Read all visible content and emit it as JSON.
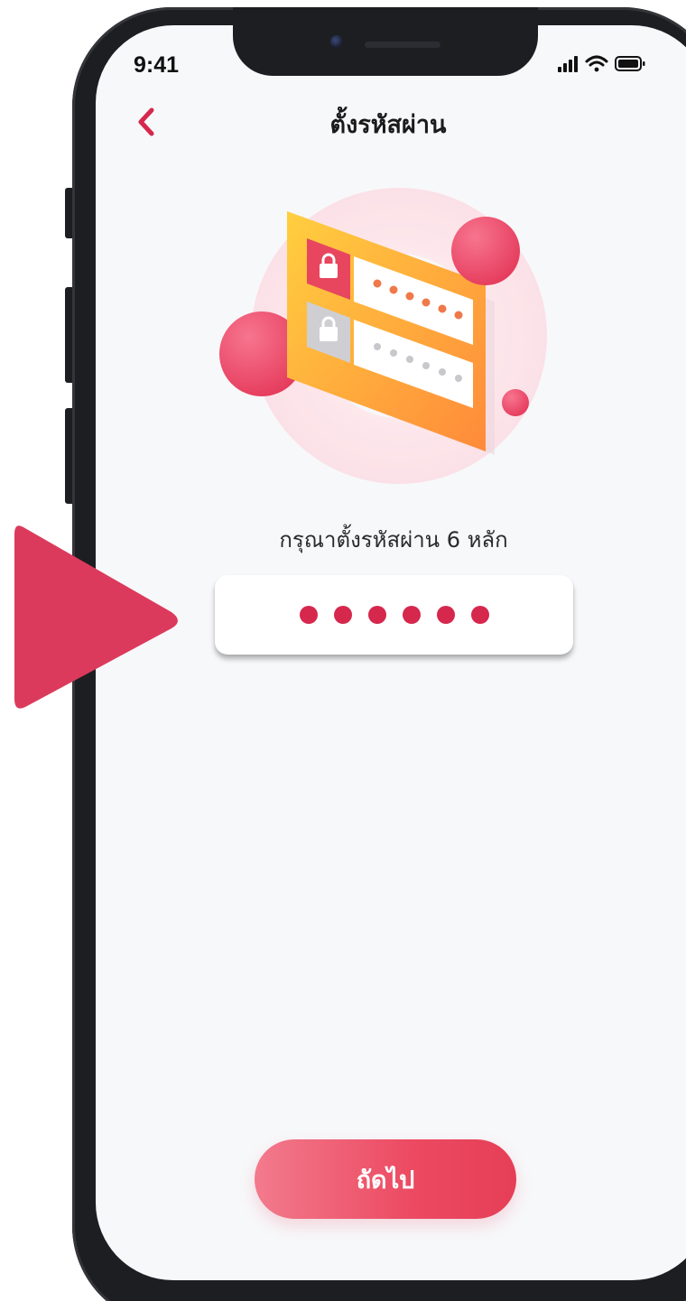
{
  "status_bar": {
    "time": "9:41",
    "signal_icon": "cellular-signal-icon",
    "wifi_icon": "wifi-icon",
    "battery_icon": "battery-icon"
  },
  "header": {
    "back_icon": "chevron-left-icon",
    "title": "ตั้งรหัสผ่าน"
  },
  "illustration": {
    "icon": "password-lock-illustration"
  },
  "pin_setup": {
    "prompt": "กรุณาตั้งรหัสผ่าน 6 หลัก",
    "entered_digits": 6,
    "total_digits": 6
  },
  "footer": {
    "next_label": "ถัดไป"
  },
  "overlay": {
    "icon": "play-arrow-icon"
  },
  "colors": {
    "accent": "#d6274d",
    "button_gradient_start": "#f27a8c",
    "button_gradient_end": "#e63e57",
    "screen_background": "#f7f8fa",
    "device_frame": "#1d1e22"
  }
}
